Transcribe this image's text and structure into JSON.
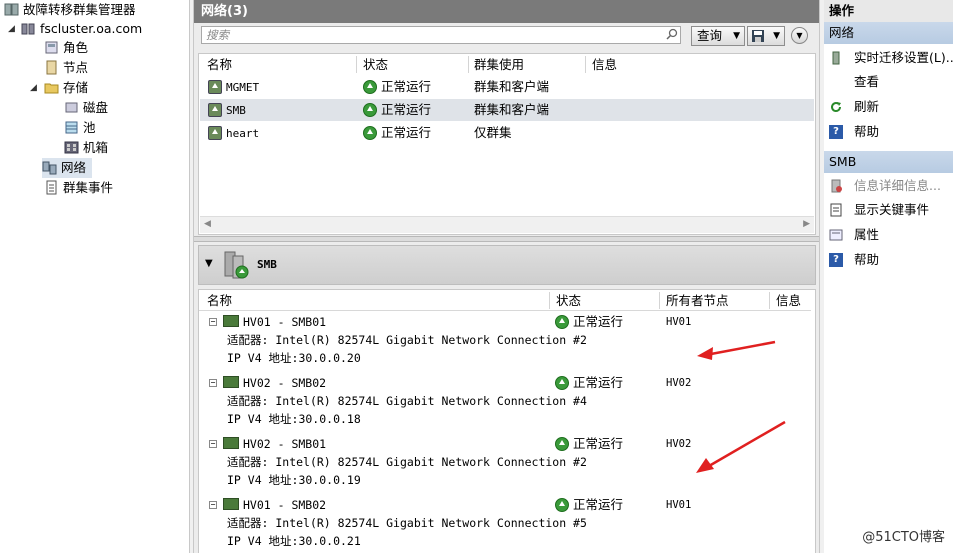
{
  "tree": {
    "root": "故障转移群集管理器",
    "cluster": "fscluster.oa.com",
    "nodes": [
      "角色",
      "节点",
      "存储",
      "磁盘",
      "池",
      "机箱",
      "网络",
      "群集事件"
    ]
  },
  "center": {
    "title": "网络(3)",
    "search_placeholder": "搜索",
    "query_label": "查询",
    "columns": [
      "名称",
      "状态",
      "群集使用",
      "信息"
    ],
    "networks": [
      {
        "name": "MGMET",
        "status": "正常运行",
        "usage": "群集和客户端",
        "selected": false
      },
      {
        "name": "SMB",
        "status": "正常运行",
        "usage": "群集和客户端",
        "selected": true
      },
      {
        "name": "heart",
        "status": "正常运行",
        "usage": "仅群集",
        "selected": false
      }
    ],
    "detail": {
      "title": "SMB",
      "columns": [
        "名称",
        "状态",
        "所有者节点",
        "信息"
      ],
      "items": [
        {
          "name": "HV01 - SMB01",
          "adapter": "适配器: Intel(R) 82574L Gigabit Network Connection #2",
          "ip": "IP V4 地址:30.0.0.20",
          "status": "正常运行",
          "owner": "HV01"
        },
        {
          "name": "HV02 - SMB02",
          "adapter": "适配器: Intel(R) 82574L Gigabit Network Connection #4",
          "ip": "IP V4 地址:30.0.0.18",
          "status": "正常运行",
          "owner": "HV02"
        },
        {
          "name": "HV02 - SMB01",
          "adapter": "适配器: Intel(R) 82574L Gigabit Network Connection #2",
          "ip": "IP V4 地址:30.0.0.19",
          "status": "正常运行",
          "owner": "HV02"
        },
        {
          "name": "HV01 - SMB02",
          "adapter": "适配器: Intel(R) 82574L Gigabit Network Connection #5",
          "ip": "IP V4 地址:30.0.0.21",
          "status": "正常运行",
          "owner": "HV01"
        }
      ]
    }
  },
  "actions": {
    "header": "操作",
    "section1": "网络",
    "section1_items": [
      "实时迁移设置(L)...",
      "查看",
      "刷新",
      "帮助"
    ],
    "section2": "SMB",
    "section2_items": [
      "信息详细信息...",
      "显示关键事件",
      "属性",
      "帮助"
    ]
  },
  "watermark": "@51CTO博客",
  "colors": {
    "title_bar": "#7a7a7a",
    "status_green": "#3a9a3a",
    "arrow_red": "#e02020",
    "section_blue": "#c9d8ea"
  }
}
